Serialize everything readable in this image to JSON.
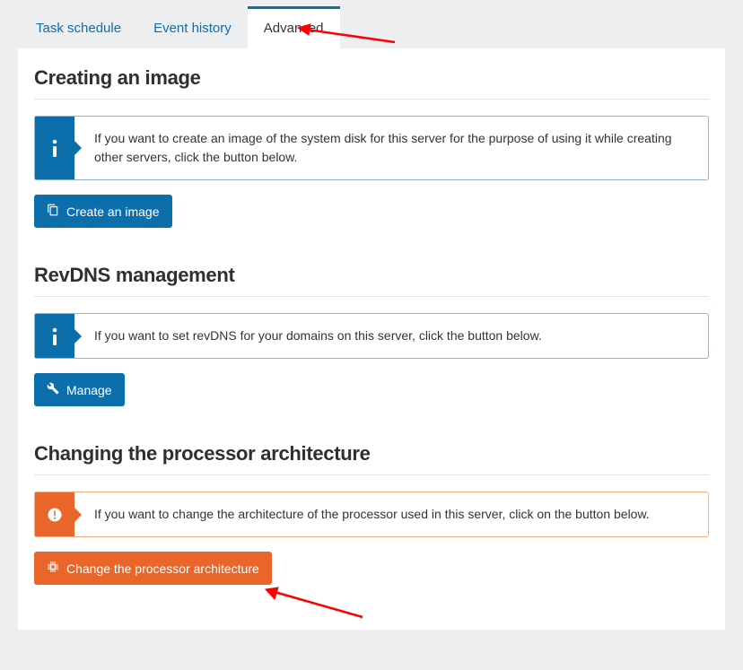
{
  "tabs": {
    "task_schedule": "Task schedule",
    "event_history": "Event history",
    "advanced": "Advanced"
  },
  "sections": {
    "create_image": {
      "title": "Creating an image",
      "info": "If you want to create an image of the system disk for this server for the purpose of using it while creating other servers, click the button below.",
      "button": "Create an image"
    },
    "revdns": {
      "title": "RevDNS management",
      "info": "If you want to set revDNS for your domains on this server, click the button below.",
      "button": "Manage"
    },
    "arch": {
      "title": "Changing the processor architecture",
      "info": "If you want to change the architecture of the processor used in this server, click on the button below.",
      "button": "Change the processor architecture"
    }
  }
}
